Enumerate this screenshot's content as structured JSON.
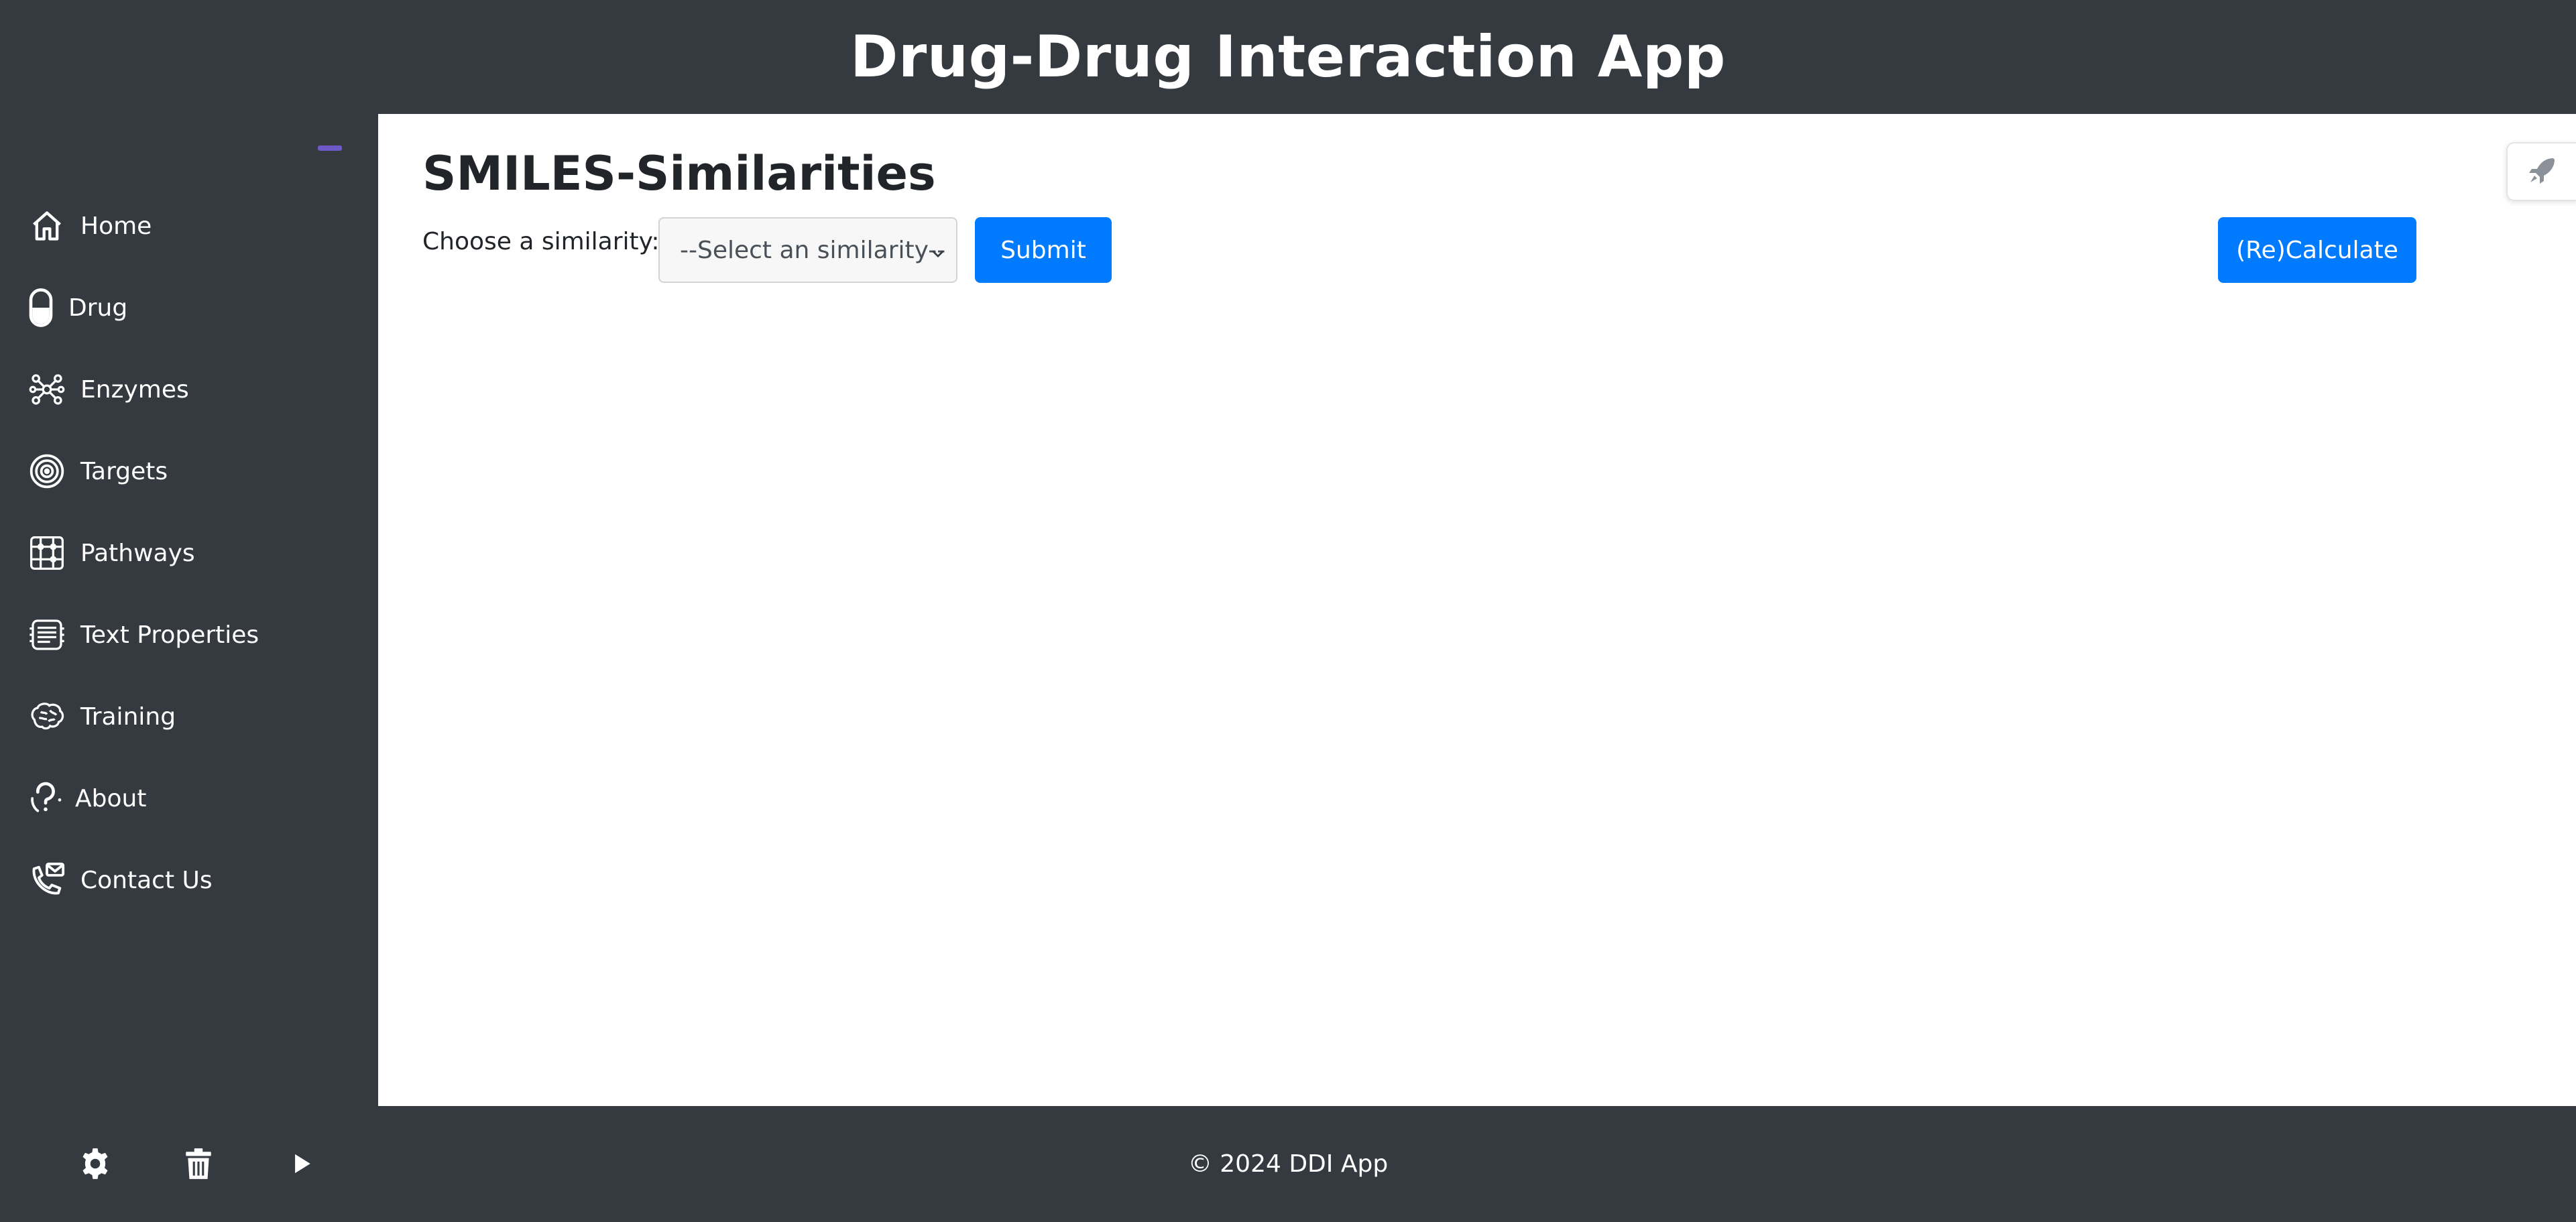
{
  "app": {
    "title": "Drug-Drug Interaction App"
  },
  "sidebar": {
    "items": [
      {
        "label": "Home",
        "icon": "home-icon"
      },
      {
        "label": "Drug",
        "icon": "pill-icon"
      },
      {
        "label": "Enzymes",
        "icon": "enzyme-icon"
      },
      {
        "label": "Targets",
        "icon": "target-icon"
      },
      {
        "label": "Pathways",
        "icon": "pathway-icon"
      },
      {
        "label": "Text Properties",
        "icon": "text-properties-icon"
      },
      {
        "label": "Training",
        "icon": "brain-icon"
      },
      {
        "label": "About",
        "icon": "question-icon"
      },
      {
        "label": "Contact Us",
        "icon": "phone-mail-icon"
      }
    ],
    "tools": [
      "gear-icon",
      "trash-icon",
      "play-icon"
    ]
  },
  "main": {
    "title": "SMILES-Similarities",
    "form": {
      "label": "Choose a similarity:",
      "select_value": "--Select an similarity--",
      "submit_label": "Submit",
      "recalculate_label": "(Re)Calculate"
    }
  },
  "footer": {
    "text": "© 2024 DDI App"
  },
  "colors": {
    "sidebar_bg": "#343a40",
    "primary": "#007bff",
    "accent_handle": "#6f59c8"
  }
}
